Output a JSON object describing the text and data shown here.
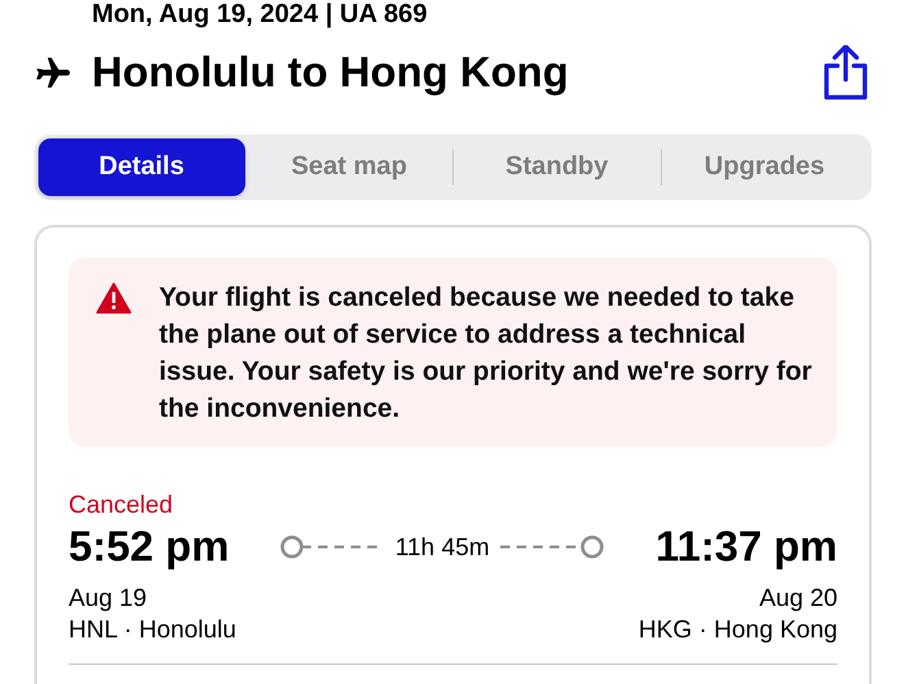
{
  "header": {
    "subtitle": "Mon, Aug 19, 2024 | UA 869",
    "title": "Honolulu to Hong Kong"
  },
  "tabs": [
    {
      "label": "Details",
      "selected": true
    },
    {
      "label": "Seat map",
      "selected": false
    },
    {
      "label": "Standby",
      "selected": false
    },
    {
      "label": "Upgrades",
      "selected": false
    }
  ],
  "alert": {
    "message": "Your flight is canceled because we needed to take the plane out of service to address a technical issue. Your safety is our priority and we're sorry for the inconvenience."
  },
  "flight": {
    "status": "Canceled",
    "duration": "11h 45m",
    "departure": {
      "time": "5:52 pm",
      "date": "Aug 19",
      "airport": "HNL · Honolulu"
    },
    "arrival": {
      "time": "11:37 pm",
      "date": "Aug 20",
      "airport": "HKG · Hong Kong"
    }
  }
}
